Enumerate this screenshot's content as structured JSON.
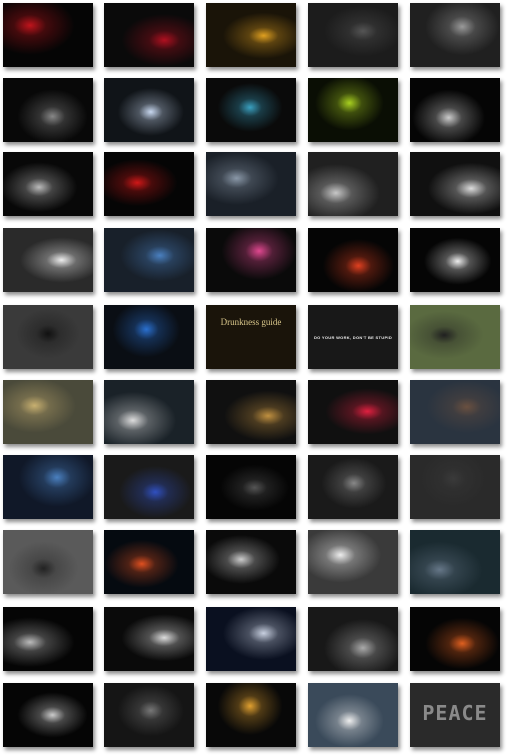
{
  "thumbnails": [
    {
      "bg": "#050505",
      "accent": "#c0141c"
    },
    {
      "bg": "#0a0a0a",
      "accent": "#b01020"
    },
    {
      "bg": "#1a1408",
      "accent": "#e0a020"
    },
    {
      "bg": "#1c1c1c",
      "accent": "#555555"
    },
    {
      "bg": "#202020",
      "accent": "#9a9a9a"
    },
    {
      "bg": "#080808",
      "accent": "#888888"
    },
    {
      "bg": "#101418",
      "accent": "#c8d8f0"
    },
    {
      "bg": "#0a0a0a",
      "accent": "#3aa0c0"
    },
    {
      "bg": "#0a0e04",
      "accent": "#a8d020"
    },
    {
      "bg": "#050505",
      "accent": "#cccccc"
    },
    {
      "bg": "#080808",
      "accent": "#bbbbbb"
    },
    {
      "bg": "#050505",
      "accent": "#d01818"
    },
    {
      "bg": "#1a2028",
      "accent": "#8a98a8"
    },
    {
      "bg": "#202020",
      "accent": "#c8c8c8"
    },
    {
      "bg": "#101010",
      "accent": "#dddddd"
    },
    {
      "bg": "#2a2a2a",
      "accent": "#eeeeee"
    },
    {
      "bg": "#18202a",
      "accent": "#4a80c0"
    },
    {
      "bg": "#0a0a0a",
      "accent": "#e04890"
    },
    {
      "bg": "#050505",
      "accent": "#e04020"
    },
    {
      "bg": "#050505",
      "accent": "#eeeeee"
    },
    {
      "bg": "#3a3a3a",
      "accent": "#111111"
    },
    {
      "bg": "#0a0e14",
      "accent": "#2a70d0"
    },
    {
      "bg": "#1a140a",
      "accent": "#d8c68a",
      "text": "Drunkness guide",
      "style": "t-serif"
    },
    {
      "bg": "#181818",
      "accent": "#ffffff",
      "text": "DO YOUR WORK, DON'T BE STUPID",
      "style": "t-caps"
    },
    {
      "bg": "#5a6a40",
      "accent": "#202020"
    },
    {
      "bg": "#4a4a3a",
      "accent": "#c8b070"
    },
    {
      "bg": "#1a2228",
      "accent": "#dddddd"
    },
    {
      "bg": "#101010",
      "accent": "#c09040"
    },
    {
      "bg": "#101010",
      "accent": "#e02040"
    },
    {
      "bg": "#2a3440",
      "accent": "#6a5040"
    },
    {
      "bg": "#101828",
      "accent": "#4a80c0"
    },
    {
      "bg": "#1a1a1a",
      "accent": "#3050c0"
    },
    {
      "bg": "#050505",
      "accent": "#555555"
    },
    {
      "bg": "#1a1a1a",
      "accent": "#888888"
    },
    {
      "bg": "#2a2a2a",
      "accent": "#3a3a3a"
    },
    {
      "bg": "#5a5a5a",
      "accent": "#222222"
    },
    {
      "bg": "#050a10",
      "accent": "#e05020"
    },
    {
      "bg": "#0a0a0a",
      "accent": "#cccccc"
    },
    {
      "bg": "#3a3a3a",
      "accent": "#eeeeee"
    },
    {
      "bg": "#1a2a30",
      "accent": "#667788"
    },
    {
      "bg": "#050505",
      "accent": "#bbbbbb"
    },
    {
      "bg": "#0a0a0a",
      "accent": "#dddddd"
    },
    {
      "bg": "#0a1020",
      "accent": "#c8d0e0"
    },
    {
      "bg": "#181818",
      "accent": "#aaaaaa"
    },
    {
      "bg": "#050505",
      "accent": "#e06020"
    },
    {
      "bg": "#050505",
      "accent": "#cccccc"
    },
    {
      "bg": "#151515",
      "accent": "#777777"
    },
    {
      "bg": "#080808",
      "accent": "#e0a030"
    },
    {
      "bg": "#3a4a5a",
      "accent": "#eeeeee"
    },
    {
      "bg": "#2a2a2a",
      "accent": "#8a8a8a",
      "text": "PEACE",
      "style": "t-peace"
    }
  ]
}
